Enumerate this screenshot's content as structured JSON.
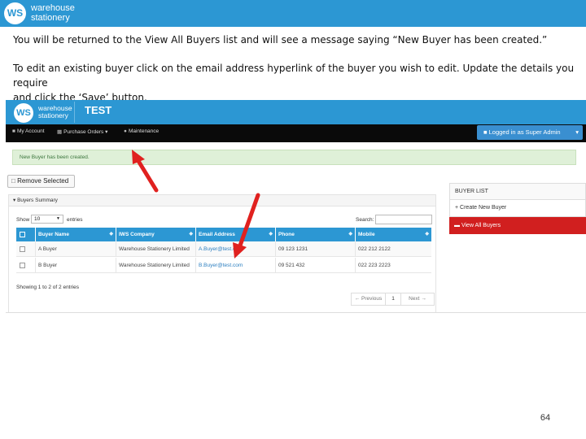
{
  "colors": {
    "brand_blue": "#2c97d3",
    "nav_black": "#0a0a0a",
    "alert_green_bg": "#dff0d8",
    "alert_green_text": "#3c763d",
    "active_red": "#d11f1f",
    "annotation_arrow": "#e0211f"
  },
  "slide": {
    "logo_mark": "WS",
    "logo_line1": "warehouse",
    "logo_line2": "stationery",
    "paragraph1": "You will be returned to the View All Buyers list and will see a message saying “New Buyer has been created.”",
    "paragraph2_line1": "To edit an existing buyer click on the email address hyperlink of the buyer you wish to edit.  Update the details you require",
    "paragraph2_line2": "and click the ‘Save’ button.",
    "page_number": "64"
  },
  "app": {
    "logo_mark": "WS",
    "logo_line1": "warehouse",
    "logo_line2": "stationery",
    "title": "TEST",
    "nav": {
      "my_account": "My Account",
      "purchase_orders": "Purchase Orders",
      "maintenance": "Maintenance",
      "logged_in": "Logged in as Super Admin"
    },
    "alert": "New Buyer has been created.",
    "remove_selected": "Remove Selected",
    "panel_title": "Buyers Summary",
    "show_label": "Show",
    "page_size": "10",
    "entries_label": "entries",
    "search_label": "Search:",
    "columns": [
      "Buyer Name",
      "IWS Company",
      "Email Address",
      "Phone",
      "Mobile"
    ],
    "rows": [
      {
        "name": "A Buyer",
        "company": "Warehouse Stationery Limited",
        "email": "A.Buyer@test.com",
        "phone": "09 123 1231",
        "mobile": "022 212 2122"
      },
      {
        "name": "B Buyer",
        "company": "Warehouse Stationery Limited",
        "email": "B.Buyer@test.com",
        "phone": "09 521 432",
        "mobile": "022 223 2223"
      }
    ],
    "showing": "Showing 1 to 2 of 2 entries",
    "pager": {
      "previous": "← Previous",
      "page": "1",
      "next": "Next →"
    },
    "buyer_list": {
      "heading": "BUYER LIST",
      "create": "Create New Buyer",
      "view_all": "View All Buyers"
    }
  }
}
